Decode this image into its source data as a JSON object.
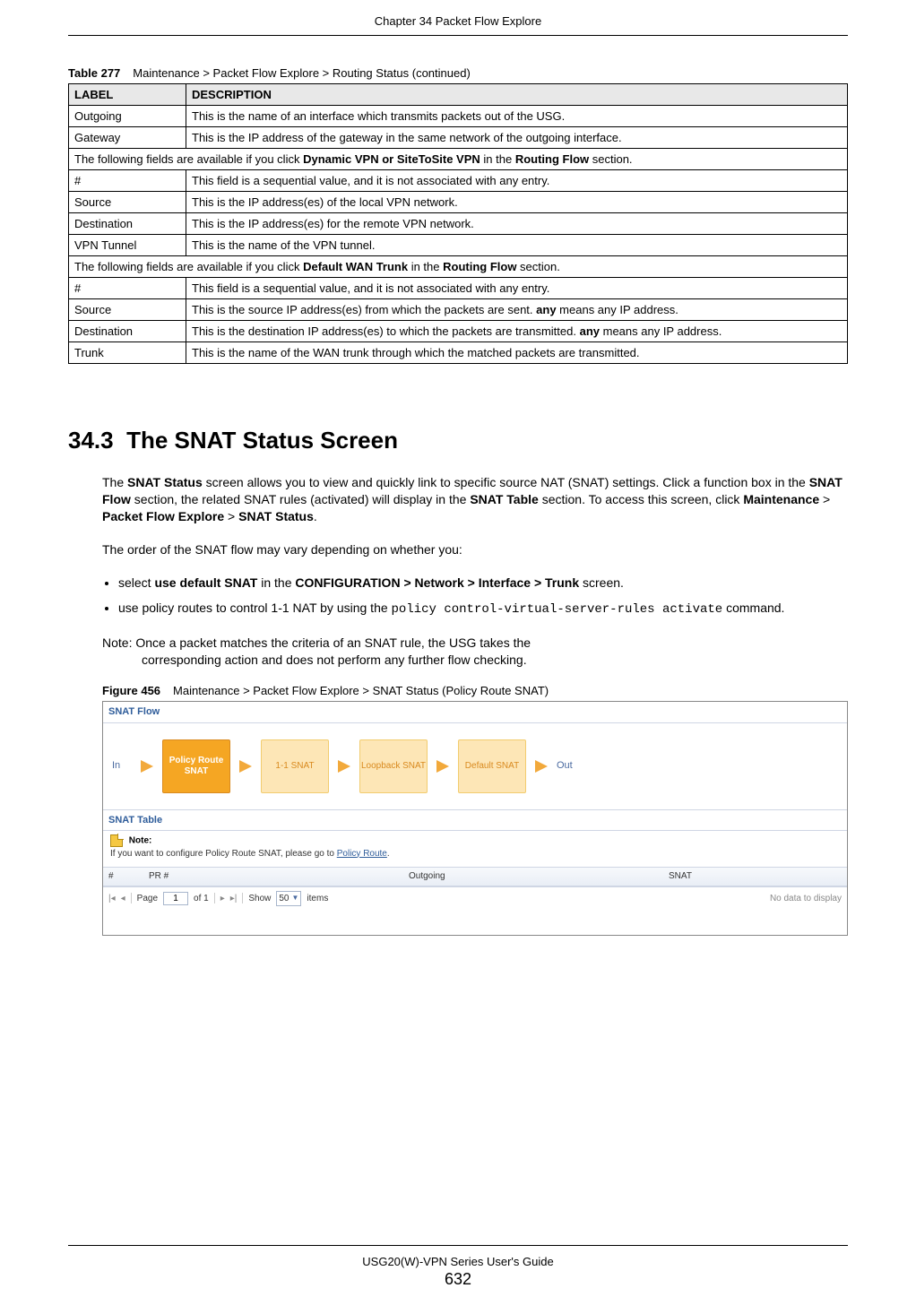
{
  "header": {
    "chapter_title": "Chapter 34 Packet Flow Explore"
  },
  "table": {
    "caption_num": "Table 277",
    "caption_text": "Maintenance > Packet Flow Explore > Routing Status (continued)",
    "head_label": "LABEL",
    "head_desc": "DESCRIPTION",
    "rows": [
      {
        "label": "Outgoing",
        "desc_plain": "This is the name of an interface which transmits packets out of the USG."
      },
      {
        "label": "Gateway",
        "desc_plain": "This is the IP address of the gateway in the same network of the outgoing interface."
      },
      {
        "span": true,
        "pre": "The following fields are available if you click ",
        "bold1": "Dynamic VPN or SiteToSite VPN",
        "mid": " in the ",
        "bold2": "Routing Flow",
        "post": " section."
      },
      {
        "label": "#",
        "desc_plain": "This field is a sequential value, and it is not associated with any entry."
      },
      {
        "label": "Source",
        "desc_plain": "This is the IP address(es) of the local VPN network."
      },
      {
        "label": "Destination",
        "desc_plain": "This is the IP address(es) for the remote VPN network."
      },
      {
        "label": "VPN Tunnel",
        "desc_plain": "This is the name of the VPN tunnel."
      },
      {
        "span": true,
        "pre": "The following fields are available if you click ",
        "bold1": "Default WAN Trunk",
        "mid": " in the ",
        "bold2": "Routing Flow",
        "post": " section."
      },
      {
        "label": "#",
        "desc_plain": "This field is a sequential value, and it is not associated with any entry."
      },
      {
        "label": "Source",
        "desc_pre": "This is the source IP address(es) from which the packets are sent. ",
        "desc_bold": "any",
        "desc_post": " means any IP address."
      },
      {
        "label": "Destination",
        "desc_pre": "This is the destination IP address(es) to which the packets are transmitted. ",
        "desc_bold": "any",
        "desc_post": " means any IP address."
      },
      {
        "label": "Trunk",
        "desc_plain": "This is the name of the WAN trunk through which the matched packets are transmitted."
      }
    ]
  },
  "section": {
    "number": "34.3",
    "title": "The SNAT Status Screen",
    "intro": {
      "p1a": "The ",
      "p1b": "SNAT Status",
      "p1c": " screen allows you to view and quickly link to specific source NAT (SNAT) settings. Click a function box in the ",
      "p1d": "SNAT Flow",
      "p1e": " section, the related SNAT rules (activated) will display in the ",
      "p1f": "SNAT Table",
      "p1g": " section. To access this screen, click ",
      "p1h": "Maintenance",
      "p1i": " > ",
      "p1j": "Packet Flow Explore",
      "p1k": " > ",
      "p1l": "SNAT Status",
      "p1m": "."
    },
    "order_intro": "The order of the SNAT flow may vary depending on whether you:",
    "bullets": {
      "b1a": "select ",
      "b1b": "use default SNAT",
      "b1c": " in the ",
      "b1d": "CONFIGURATION > Network > Interface > Trunk",
      "b1e": " screen.",
      "b2a": "use policy routes to control 1-1 NAT by using the ",
      "b2code": "policy control-virtual-server-rules activate",
      "b2b": " command."
    },
    "note": {
      "label": "Note: ",
      "line1": "Once a packet matches the criteria of an SNAT rule, the USG takes the",
      "line2": "corresponding action and does not perform any further flow checking."
    }
  },
  "figure": {
    "num": "Figure 456",
    "caption": "Maintenance > Packet Flow Explore > SNAT Status (Policy Route SNAT)",
    "flow_title": "SNAT Flow",
    "in": "In",
    "out": "Out",
    "boxes": [
      "Policy\nRoute\nSNAT",
      "1-1 SNAT",
      "Loopback\nSNAT",
      "Default\nSNAT"
    ],
    "snat_table_title": "SNAT Table",
    "note_label": "Note:",
    "note_text_pre": "If you want to configure Policy Route SNAT, please go to ",
    "note_link": "Policy Route",
    "note_text_post": ".",
    "cols": {
      "c1": "#",
      "c2": "PR #",
      "c3": "Outgoing",
      "c4": "SNAT"
    },
    "pager": {
      "page_label": "Page",
      "page_val": "1",
      "of": "of 1",
      "show": "Show",
      "show_val": "50",
      "items": "items",
      "nodata": "No data to display"
    }
  },
  "footer": {
    "guide": "USG20(W)-VPN Series User's Guide",
    "page": "632"
  }
}
